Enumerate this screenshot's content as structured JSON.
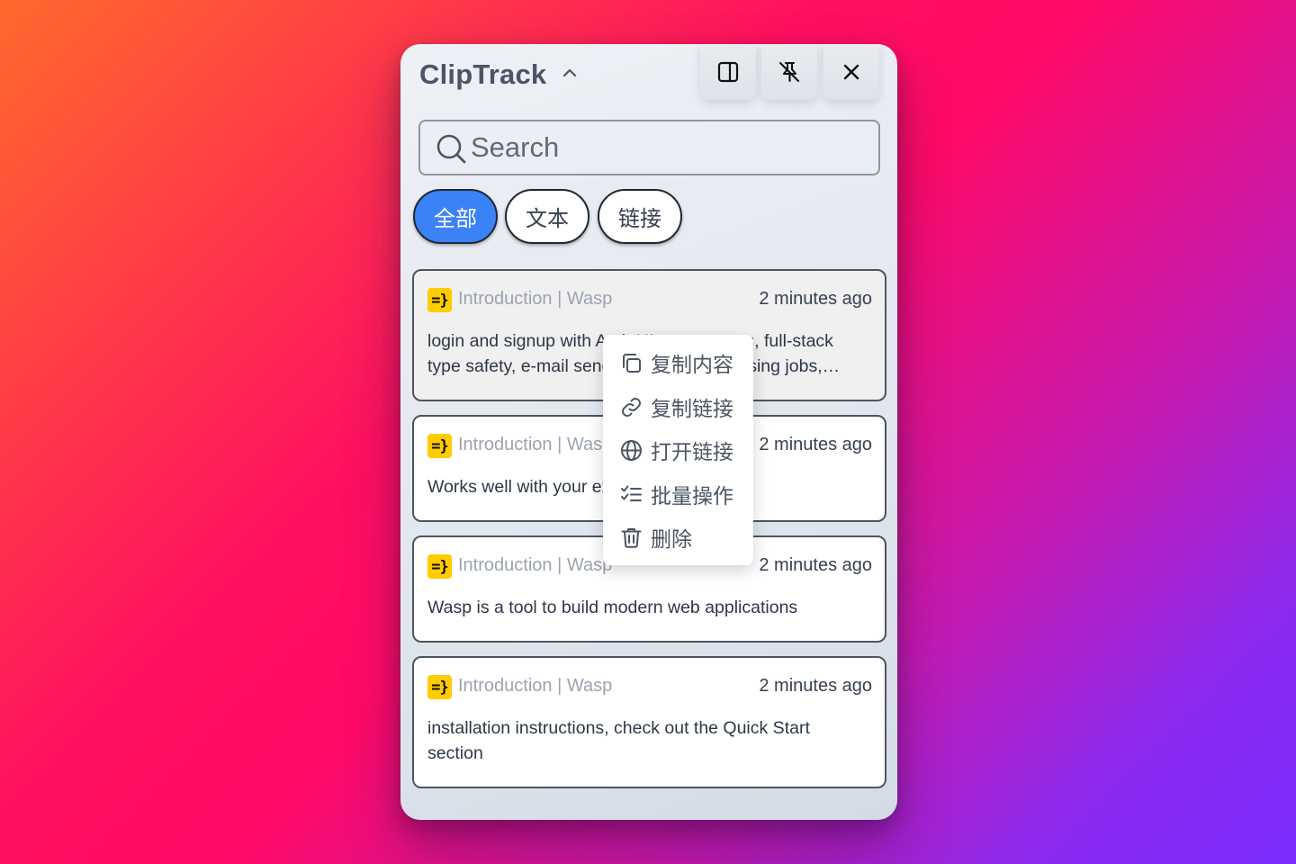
{
  "app": {
    "title": "ClipTrack"
  },
  "search": {
    "placeholder": "Search"
  },
  "filters": [
    {
      "label": "全部",
      "active": true
    },
    {
      "label": "文本",
      "active": false
    },
    {
      "label": "链接",
      "active": false
    }
  ],
  "clips": [
    {
      "favicon_text": "=}",
      "source": "Introduction | Wasp",
      "time": "2 minutes ago",
      "text": "login and signup with Auth UI components, full-stack type safety, e-mail sending, async processing jobs, React Query powered data fetching, and more."
    },
    {
      "favicon_text": "=}",
      "source": "Introduction | Wasp",
      "time": "2 minutes ago",
      "text": "Works well with your existing stack"
    },
    {
      "favicon_text": "=}",
      "source": "Introduction | Wasp",
      "time": "2 minutes ago",
      "text": "Wasp is a tool to build modern web applications"
    },
    {
      "favicon_text": "=}",
      "source": "Introduction | Wasp",
      "time": "2 minutes ago",
      "text": "installation instructions, check out the Quick Start section"
    }
  ],
  "context_menu": {
    "items": [
      {
        "label": "复制内容",
        "icon": "copy-icon"
      },
      {
        "label": "复制链接",
        "icon": "link-icon"
      },
      {
        "label": "打开链接",
        "icon": "globe-icon"
      },
      {
        "label": "批量操作",
        "icon": "checklist-icon"
      },
      {
        "label": "删除",
        "icon": "trash-icon"
      }
    ]
  },
  "colors": {
    "accent": "#3b82f6",
    "favicon_bg": "#ffcc00",
    "title": "#4a5568"
  }
}
